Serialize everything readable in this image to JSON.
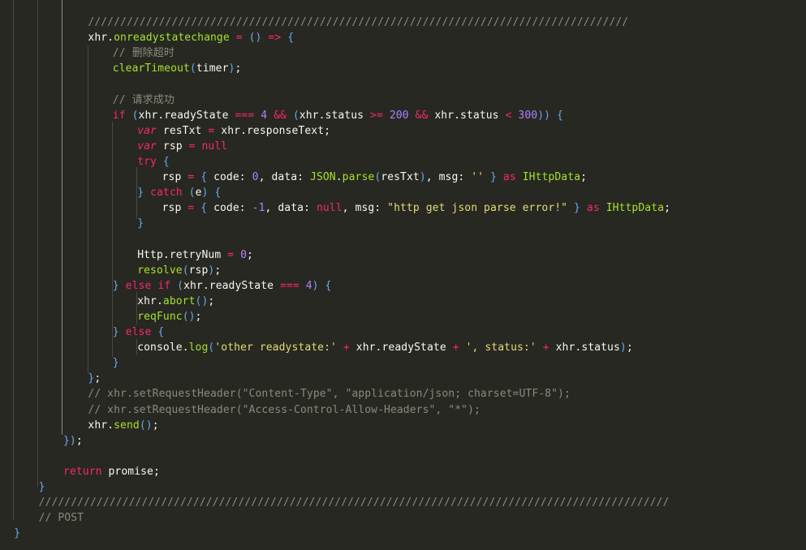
{
  "editor": {
    "theme_colors": {
      "background": "#272822",
      "keyword": "#f92672",
      "function": "#a6e22e",
      "number": "#ae81ff",
      "string": "#e6db74",
      "comment": "#8b8a7c",
      "text": "#f8f8f2",
      "bracket": "#66a9ef",
      "indent_guide": "#4a4a44"
    },
    "lines": [
      {
        "indent": 14,
        "tokens": [
          [
            "c",
            "////////////////////////////////////////////////////////////////////////////////////"
          ]
        ]
      },
      {
        "indent": 14,
        "tokens": [
          [
            "id",
            "xhr"
          ],
          [
            "p",
            "."
          ],
          [
            "f",
            "onreadystatechange"
          ],
          [
            "p",
            " "
          ],
          [
            "o",
            "="
          ],
          [
            "p",
            " "
          ],
          [
            "b",
            "()"
          ],
          [
            "p",
            " "
          ],
          [
            "o",
            "=>"
          ],
          [
            "p",
            " "
          ],
          [
            "b",
            "{"
          ]
        ]
      },
      {
        "indent": 18,
        "tokens": [
          [
            "c",
            "// 删除超时"
          ]
        ]
      },
      {
        "indent": 18,
        "tokens": [
          [
            "f",
            "clearTimeout"
          ],
          [
            "b",
            "("
          ],
          [
            "id",
            "timer"
          ],
          [
            "b",
            ")"
          ],
          [
            "p",
            ";"
          ]
        ]
      },
      {
        "indent": 0,
        "tokens": []
      },
      {
        "indent": 18,
        "tokens": [
          [
            "c",
            "// 请求成功"
          ]
        ]
      },
      {
        "indent": 18,
        "tokens": [
          [
            "k",
            "if"
          ],
          [
            "p",
            " "
          ],
          [
            "b",
            "("
          ],
          [
            "id",
            "xhr"
          ],
          [
            "p",
            "."
          ],
          [
            "mem",
            "readyState"
          ],
          [
            "p",
            " "
          ],
          [
            "o",
            "==="
          ],
          [
            "p",
            " "
          ],
          [
            "n",
            "4"
          ],
          [
            "p",
            " "
          ],
          [
            "o",
            "&&"
          ],
          [
            "p",
            " "
          ],
          [
            "b",
            "("
          ],
          [
            "id",
            "xhr"
          ],
          [
            "p",
            "."
          ],
          [
            "mem",
            "status"
          ],
          [
            "p",
            " "
          ],
          [
            "o",
            ">="
          ],
          [
            "p",
            " "
          ],
          [
            "n",
            "200"
          ],
          [
            "p",
            " "
          ],
          [
            "o",
            "&&"
          ],
          [
            "p",
            " "
          ],
          [
            "id",
            "xhr"
          ],
          [
            "p",
            "."
          ],
          [
            "mem",
            "status"
          ],
          [
            "p",
            " "
          ],
          [
            "o",
            "<"
          ],
          [
            "p",
            " "
          ],
          [
            "n",
            "300"
          ],
          [
            "b",
            "))"
          ],
          [
            "p",
            " "
          ],
          [
            "b",
            "{"
          ]
        ]
      },
      {
        "indent": 22,
        "tokens": [
          [
            "v",
            "var"
          ],
          [
            "p",
            " "
          ],
          [
            "id",
            "resTxt"
          ],
          [
            "p",
            " "
          ],
          [
            "o",
            "="
          ],
          [
            "p",
            " "
          ],
          [
            "id",
            "xhr"
          ],
          [
            "p",
            "."
          ],
          [
            "mem",
            "responseText"
          ],
          [
            "p",
            ";"
          ]
        ]
      },
      {
        "indent": 22,
        "tokens": [
          [
            "v",
            "var"
          ],
          [
            "p",
            " "
          ],
          [
            "id",
            "rsp"
          ],
          [
            "p",
            " "
          ],
          [
            "o",
            "="
          ],
          [
            "p",
            " "
          ],
          [
            "k",
            "null"
          ]
        ]
      },
      {
        "indent": 22,
        "tokens": [
          [
            "k",
            "try"
          ],
          [
            "p",
            " "
          ],
          [
            "b",
            "{"
          ]
        ]
      },
      {
        "indent": 26,
        "tokens": [
          [
            "id",
            "rsp"
          ],
          [
            "p",
            " "
          ],
          [
            "o",
            "="
          ],
          [
            "p",
            " "
          ],
          [
            "b",
            "{"
          ],
          [
            "p",
            " "
          ],
          [
            "id",
            "code"
          ],
          [
            "p",
            ": "
          ],
          [
            "n",
            "0"
          ],
          [
            "p",
            ", "
          ],
          [
            "id",
            "data"
          ],
          [
            "p",
            ": "
          ],
          [
            "cl",
            "JSON"
          ],
          [
            "p",
            "."
          ],
          [
            "f",
            "parse"
          ],
          [
            "b",
            "("
          ],
          [
            "id",
            "resTxt"
          ],
          [
            "b",
            ")"
          ],
          [
            "p",
            ", "
          ],
          [
            "id",
            "msg"
          ],
          [
            "p",
            ": "
          ],
          [
            "s",
            "''"
          ],
          [
            "p",
            " "
          ],
          [
            "b",
            "}"
          ],
          [
            "p",
            " "
          ],
          [
            "k",
            "as"
          ],
          [
            "p",
            " "
          ],
          [
            "cl",
            "IHttpData"
          ],
          [
            "p",
            ";"
          ]
        ]
      },
      {
        "indent": 22,
        "tokens": [
          [
            "b",
            "}"
          ],
          [
            "p",
            " "
          ],
          [
            "k",
            "catch"
          ],
          [
            "p",
            " "
          ],
          [
            "b",
            "("
          ],
          [
            "id",
            "e"
          ],
          [
            "b",
            ")"
          ],
          [
            "p",
            " "
          ],
          [
            "b",
            "{"
          ]
        ]
      },
      {
        "indent": 26,
        "tokens": [
          [
            "id",
            "rsp"
          ],
          [
            "p",
            " "
          ],
          [
            "o",
            "="
          ],
          [
            "p",
            " "
          ],
          [
            "b",
            "{"
          ],
          [
            "p",
            " "
          ],
          [
            "id",
            "code"
          ],
          [
            "p",
            ": "
          ],
          [
            "n",
            "-1"
          ],
          [
            "p",
            ", "
          ],
          [
            "id",
            "data"
          ],
          [
            "p",
            ": "
          ],
          [
            "k",
            "null"
          ],
          [
            "p",
            ", "
          ],
          [
            "id",
            "msg"
          ],
          [
            "p",
            ": "
          ],
          [
            "s",
            "\"http get json parse error!\""
          ],
          [
            "p",
            " "
          ],
          [
            "b",
            "}"
          ],
          [
            "p",
            " "
          ],
          [
            "k",
            "as"
          ],
          [
            "p",
            " "
          ],
          [
            "cl",
            "IHttpData"
          ],
          [
            "p",
            ";"
          ]
        ]
      },
      {
        "indent": 22,
        "tokens": [
          [
            "b",
            "}"
          ]
        ]
      },
      {
        "indent": 0,
        "tokens": []
      },
      {
        "indent": 22,
        "tokens": [
          [
            "id",
            "Http"
          ],
          [
            "p",
            "."
          ],
          [
            "mem",
            "retryNum"
          ],
          [
            "p",
            " "
          ],
          [
            "o",
            "="
          ],
          [
            "p",
            " "
          ],
          [
            "n",
            "0"
          ],
          [
            "p",
            ";"
          ]
        ]
      },
      {
        "indent": 22,
        "tokens": [
          [
            "f",
            "resolve"
          ],
          [
            "b",
            "("
          ],
          [
            "id",
            "rsp"
          ],
          [
            "b",
            ")"
          ],
          [
            "p",
            ";"
          ]
        ]
      },
      {
        "indent": 18,
        "tokens": [
          [
            "b",
            "}"
          ],
          [
            "p",
            " "
          ],
          [
            "k",
            "else"
          ],
          [
            "p",
            " "
          ],
          [
            "k",
            "if"
          ],
          [
            "p",
            " "
          ],
          [
            "b",
            "("
          ],
          [
            "id",
            "xhr"
          ],
          [
            "p",
            "."
          ],
          [
            "mem",
            "readyState"
          ],
          [
            "p",
            " "
          ],
          [
            "o",
            "==="
          ],
          [
            "p",
            " "
          ],
          [
            "n",
            "4"
          ],
          [
            "b",
            ")"
          ],
          [
            "p",
            " "
          ],
          [
            "b",
            "{"
          ]
        ]
      },
      {
        "indent": 22,
        "tokens": [
          [
            "id",
            "xhr"
          ],
          [
            "p",
            "."
          ],
          [
            "f",
            "abort"
          ],
          [
            "b",
            "()"
          ],
          [
            "p",
            ";"
          ]
        ]
      },
      {
        "indent": 22,
        "tokens": [
          [
            "f",
            "reqFunc"
          ],
          [
            "b",
            "()"
          ],
          [
            "p",
            ";"
          ]
        ]
      },
      {
        "indent": 18,
        "tokens": [
          [
            "b",
            "}"
          ],
          [
            "p",
            " "
          ],
          [
            "k",
            "else"
          ],
          [
            "p",
            " "
          ],
          [
            "b",
            "{"
          ]
        ]
      },
      {
        "indent": 22,
        "tokens": [
          [
            "id",
            "console"
          ],
          [
            "p",
            "."
          ],
          [
            "f",
            "log"
          ],
          [
            "b",
            "("
          ],
          [
            "s",
            "'other readystate:'"
          ],
          [
            "p",
            " "
          ],
          [
            "o",
            "+"
          ],
          [
            "p",
            " "
          ],
          [
            "id",
            "xhr"
          ],
          [
            "p",
            "."
          ],
          [
            "mem",
            "readyState"
          ],
          [
            "p",
            " "
          ],
          [
            "o",
            "+"
          ],
          [
            "p",
            " "
          ],
          [
            "s",
            "', status:'"
          ],
          [
            "p",
            " "
          ],
          [
            "o",
            "+"
          ],
          [
            "p",
            " "
          ],
          [
            "id",
            "xhr"
          ],
          [
            "p",
            "."
          ],
          [
            "mem",
            "status"
          ],
          [
            "b",
            ")"
          ],
          [
            "p",
            ";"
          ]
        ]
      },
      {
        "indent": 18,
        "tokens": [
          [
            "b",
            "}"
          ]
        ]
      },
      {
        "indent": 14,
        "tokens": [
          [
            "b",
            "}"
          ],
          [
            "p",
            ";"
          ]
        ]
      },
      {
        "indent": 14,
        "tokens": [
          [
            "c",
            "// xhr.setRequestHeader(\"Content-Type\", \"application/json; charset=UTF-8\");"
          ]
        ]
      },
      {
        "indent": 14,
        "tokens": [
          [
            "c",
            "// xhr.setRequestHeader(\"Access-Control-Allow-Headers\", \"*\");"
          ]
        ]
      },
      {
        "indent": 14,
        "tokens": [
          [
            "id",
            "xhr"
          ],
          [
            "p",
            "."
          ],
          [
            "f",
            "send"
          ],
          [
            "b",
            "()"
          ],
          [
            "p",
            ";"
          ]
        ]
      },
      {
        "indent": 10,
        "tokens": [
          [
            "b",
            "})"
          ],
          [
            "p",
            ";"
          ]
        ]
      },
      {
        "indent": 0,
        "tokens": []
      },
      {
        "indent": 10,
        "tokens": [
          [
            "k",
            "return"
          ],
          [
            "p",
            " "
          ],
          [
            "id",
            "promise"
          ],
          [
            "p",
            ";"
          ]
        ]
      },
      {
        "indent": 6,
        "tokens": [
          [
            "b",
            "}"
          ]
        ]
      },
      {
        "indent": 6,
        "tokens": [
          [
            "c",
            "//////////////////////////////////////////////////////////////////////////////////////////////////"
          ]
        ]
      },
      {
        "indent": 6,
        "tokens": [
          [
            "c",
            "// POST"
          ]
        ]
      },
      {
        "indent": 2,
        "tokens": [
          [
            "b",
            "}"
          ]
        ]
      }
    ]
  }
}
